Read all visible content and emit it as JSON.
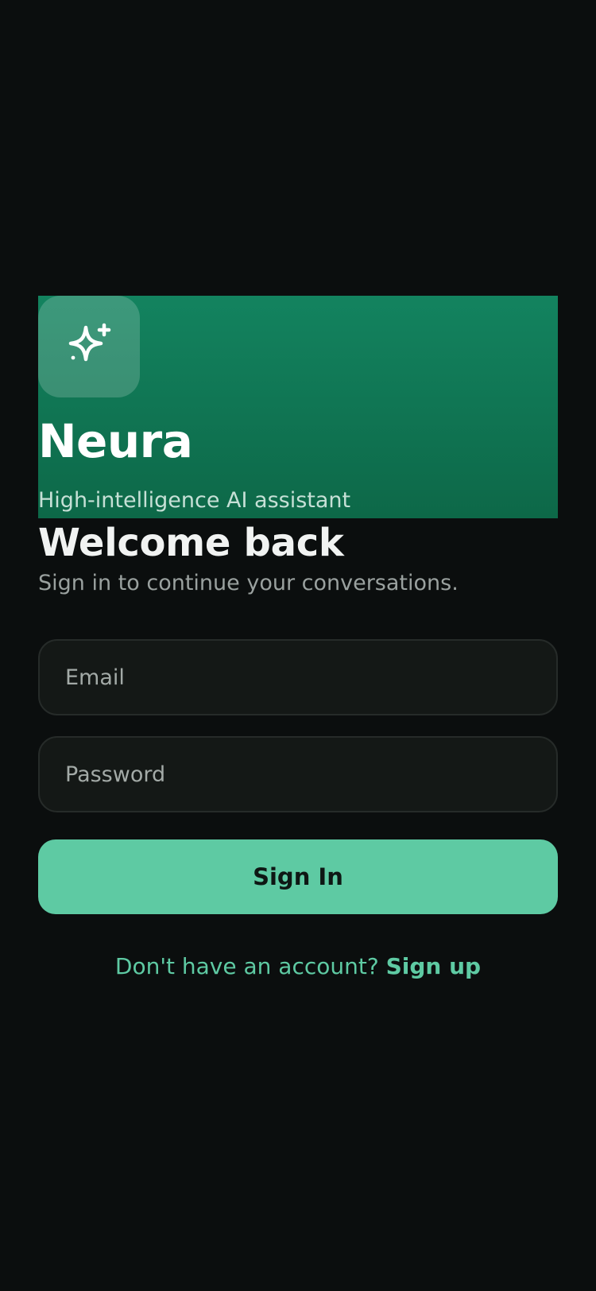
{
  "hero": {
    "app_icon": "sparkles-icon",
    "app_name": "Neura",
    "tagline": "High-intelligence AI assistant",
    "gradient_top": "#13835f",
    "gradient_bottom": "#0d6848"
  },
  "login": {
    "title": "Welcome back",
    "subtitle": "Sign in to continue your conversations.",
    "email_placeholder": "Email",
    "email_value": "",
    "password_placeholder": "Password",
    "password_value": "",
    "sign_in_label": "Sign In",
    "signup_prompt": "Don't have an account?",
    "signup_link": "Sign up"
  },
  "colors": {
    "background": "#0b0e0e",
    "accent": "#5ecaa3",
    "field_background": "#141816"
  }
}
